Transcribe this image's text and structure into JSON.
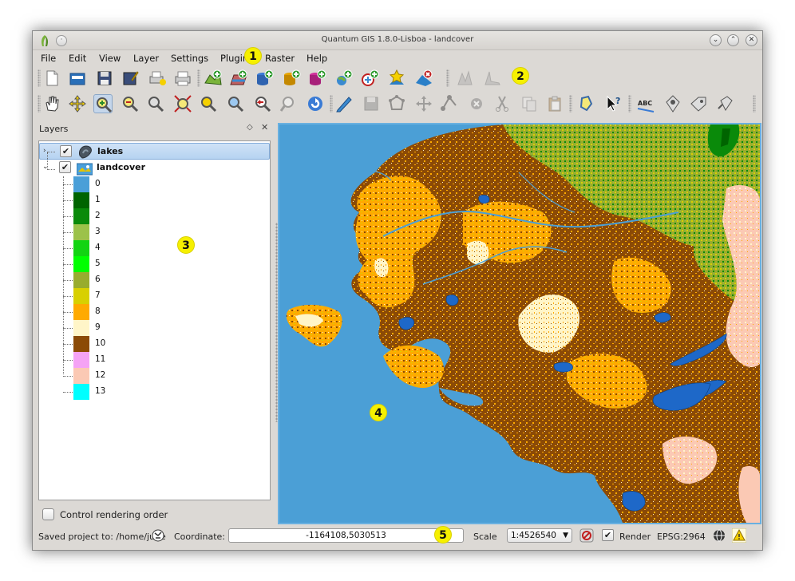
{
  "window": {
    "title": "Quantum GIS 1.8.0-Lisboa - landcover",
    "menu_dot": "·"
  },
  "menu": {
    "items": [
      "File",
      "Edit",
      "View",
      "Layer",
      "Settings",
      "Plugins",
      "Raster",
      "Help"
    ]
  },
  "toolbar1": {
    "icons": [
      "new-project-icon",
      "open-project-icon",
      "save-project-icon",
      "save-as-icon",
      "print-composer-icon",
      "print-icon",
      "add-vector-layer-icon",
      "add-raster-layer-icon",
      "add-postgis-layer-icon",
      "add-spatialite-layer-icon",
      "add-mssql-layer-icon",
      "add-wms-layer-icon",
      "add-wfs-layer-icon",
      "new-shapefile-icon",
      "remove-layer-icon",
      "raster-histogram-stretch-icon",
      "raster-local-stretch-icon"
    ]
  },
  "toolbar2": {
    "icons": [
      "pan-icon",
      "pan-to-selection-icon",
      "zoom-in-icon",
      "zoom-out-icon",
      "zoom-actual-size-icon",
      "zoom-full-icon",
      "zoom-to-selection-icon",
      "zoom-to-layer-icon",
      "zoom-last-icon",
      "zoom-next-icon",
      "refresh-icon",
      "toggle-editing-icon",
      "save-edits-icon",
      "add-feature-icon",
      "move-feature-icon",
      "node-tool-icon",
      "delete-selected-icon",
      "cut-features-icon",
      "copy-features-icon",
      "paste-features-icon",
      "select-features-icon",
      "identify-icon",
      "label-icon",
      "pin-labels-icon",
      "show-hide-labels-icon",
      "move-label-icon"
    ]
  },
  "layers_panel": {
    "title": "Layers",
    "float_glyph": "◇",
    "close_glyph": "✕",
    "layers": [
      {
        "name": "lakes",
        "checked": true,
        "expanded": false,
        "selected": true,
        "icon": "vector-polygon-icon"
      },
      {
        "name": "landcover",
        "checked": true,
        "expanded": true,
        "selected": false,
        "icon": "raster-layer-icon"
      }
    ],
    "expander_collapsed": "›",
    "expander_expanded": "⌄",
    "check_glyph": "✔",
    "legend": [
      {
        "label": "0",
        "color": "#4a9fd8"
      },
      {
        "label": "1",
        "color": "#006400"
      },
      {
        "label": "2",
        "color": "#0a8a0a"
      },
      {
        "label": "3",
        "color": "#9cc24a"
      },
      {
        "label": "4",
        "color": "#12d412"
      },
      {
        "label": "5",
        "color": "#00ff00"
      },
      {
        "label": "6",
        "color": "#98ac2e"
      },
      {
        "label": "7",
        "color": "#d8d000"
      },
      {
        "label": "8",
        "color": "#ffaa00"
      },
      {
        "label": "9",
        "color": "#fff5c8"
      },
      {
        "label": "10",
        "color": "#8b4a06"
      },
      {
        "label": "11",
        "color": "#f5a3f5"
      },
      {
        "label": "12",
        "color": "#fbc9b4"
      },
      {
        "label": "13",
        "color": "#00ffff"
      }
    ],
    "control_rendering_order": {
      "label": "Control rendering order",
      "checked": false
    }
  },
  "map": {
    "water_color": "#4b9fd6",
    "lake_color": "#1e68c8"
  },
  "statusbar": {
    "saved_text": "Saved project to: /home/june",
    "coordinate_label": "Coordinate:",
    "coordinate_value": "-1164108,5030513",
    "scale_label": "Scale",
    "scale_value": "1:4526540",
    "scale_arrow": "▼",
    "render_label": "Render",
    "render_checked": true,
    "crs": "EPSG:2964"
  },
  "callouts": [
    "1",
    "2",
    "3",
    "4",
    "5"
  ],
  "colors": {
    "window_bg": "#dcd9d5",
    "selection": "#b6d3f1",
    "callout": "#f6f000"
  }
}
